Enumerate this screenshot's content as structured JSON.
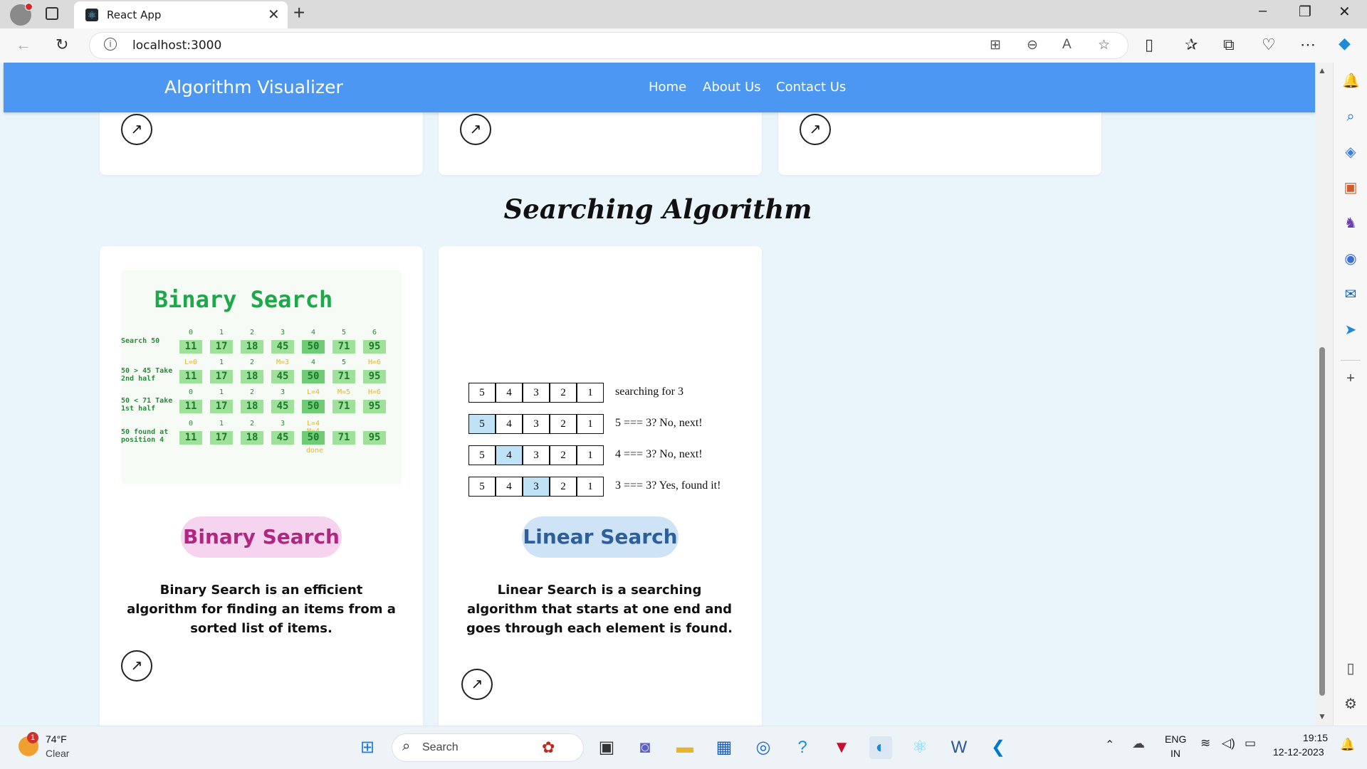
{
  "browser": {
    "tab_title": "React App",
    "tab_close": "✕",
    "new_tab": "+",
    "address": "localhost:3000",
    "window_controls": [
      "–",
      "❐",
      "✕"
    ]
  },
  "site": {
    "brand": "Algorithm Visualizer",
    "nav": [
      "Home",
      "About Us",
      "Contact Us"
    ]
  },
  "section": {
    "title": "Searching Algorithm"
  },
  "cards": [
    {
      "name": "Binary Search",
      "description": "Binary Search is an efficient algorithm for finding an items from a sorted list of items.",
      "pill_color": "#f6d3ef",
      "text_color": "#b0277f"
    },
    {
      "name": "Linear Search",
      "description": "Linear Search is a searching algorithm that starts at one end and goes through each element is found.",
      "pill_color": "#cfe3f7",
      "text_color": "#2c5f9b"
    }
  ],
  "binary_illustration": {
    "title": "Binary Search",
    "values": [
      "11",
      "17",
      "18",
      "45",
      "50",
      "71",
      "95"
    ],
    "rows": [
      {
        "label": "Search 50",
        "indices": [
          "0",
          "1",
          "2",
          "3",
          "4",
          "5",
          "6"
        ]
      },
      {
        "label": "50 > 45 Take 2nd half",
        "indices": [
          "L=0",
          "1",
          "2",
          "M=3",
          "4",
          "5",
          "H=6"
        ]
      },
      {
        "label": "50 < 71 Take 1st half",
        "indices": [
          "0",
          "1",
          "2",
          "3",
          "L=4",
          "M=5",
          "H=6"
        ]
      },
      {
        "label": "50 found at position 4",
        "indices": [
          "0",
          "1",
          "2",
          "3",
          "L=4 M=4",
          "",
          ""
        ]
      }
    ],
    "done": "done"
  },
  "linear_illustration": {
    "values": [
      "5",
      "4",
      "3",
      "2",
      "1"
    ],
    "rows": [
      {
        "text": "searching for 3",
        "highlight": -1
      },
      {
        "text": "5 === 3? No, next!",
        "highlight": 0
      },
      {
        "text": "4 === 3? No, next!",
        "highlight": 1
      },
      {
        "text": "3 === 3? Yes, found it!",
        "highlight": 2
      }
    ]
  },
  "taskbar": {
    "weather_temp": "74°F",
    "weather_desc": "Clear",
    "weather_badge": "1",
    "search_placeholder": "Search",
    "lang_line1": "ENG",
    "lang_line2": "IN",
    "time": "19:15",
    "date": "12-12-2023"
  }
}
